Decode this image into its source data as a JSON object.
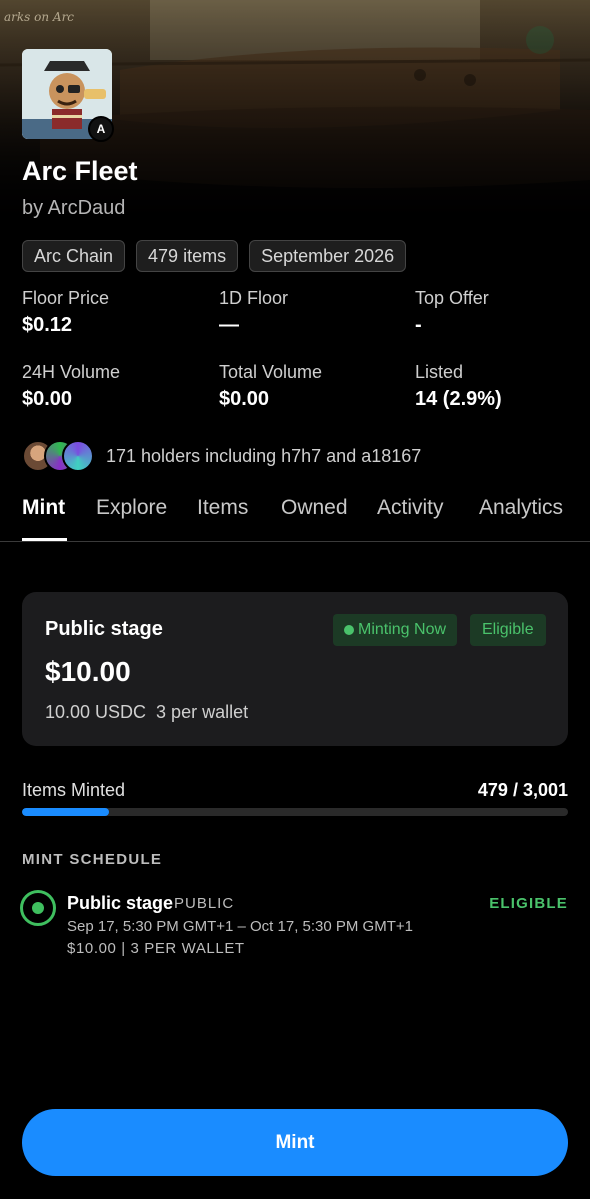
{
  "banner": {
    "text": "arks on Arc"
  },
  "collection": {
    "title": "Arc Fleet",
    "creator": "by ArcDaud",
    "chain_badge": "A",
    "chips": [
      "Arc Chain",
      "479 items",
      "September 2026"
    ]
  },
  "stats": [
    {
      "label": "Floor Price",
      "value": "$0.12"
    },
    {
      "label": "1D Floor",
      "value": "—"
    },
    {
      "label": "Top Offer",
      "value": "-"
    },
    {
      "label": "24H Volume",
      "value": "$0.00"
    },
    {
      "label": "Total Volume",
      "value": "$0.00"
    },
    {
      "label": "Listed",
      "value": "14 (2.9%)"
    }
  ],
  "holders": {
    "text": "171 holders including h7h7 and a18167"
  },
  "tabs": [
    "Mint",
    "Explore",
    "Items",
    "Owned",
    "Activity",
    "Analytics"
  ],
  "active_tab": "Mint",
  "stage_card": {
    "title": "Public stage",
    "badge_minting": "Minting Now",
    "badge_eligible": "Eligible",
    "price": "$10.00",
    "sub": "10.00 USDC  3 per wallet"
  },
  "minted": {
    "label": "Items Minted",
    "value": "479 / 3,001",
    "progress": 0.16
  },
  "schedule": {
    "header": "MINT SCHEDULE",
    "name": "Public stage",
    "tag": "PUBLIC",
    "status": "ELIGIBLE",
    "dates": "Sep 17, 5:30 PM GMT+1 – Oct 17, 5:30 PM GMT+1",
    "price": "$10.00 | 3 PER WALLET"
  },
  "mint_button": {
    "label": "Mint"
  },
  "colors": {
    "accent": "#1a8cff",
    "success": "#4ac26b",
    "card": "#1c1c1e"
  },
  "icons": {
    "chain_badge": "arc-logo-icon",
    "schedule_status": "radio-active-icon"
  }
}
